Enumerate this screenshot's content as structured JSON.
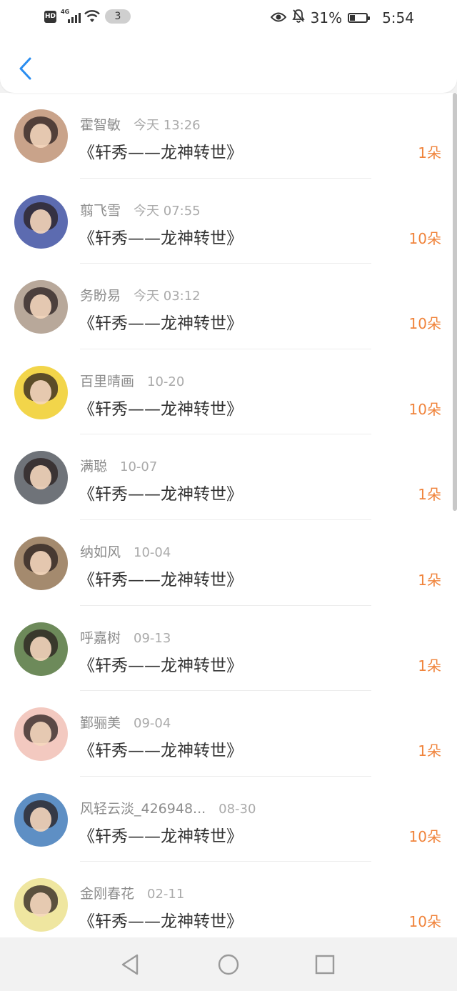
{
  "status_bar": {
    "hd_label": "HD",
    "network_label": "4G",
    "notification_count": "3",
    "battery_percent": "31%",
    "battery_level": 0.31,
    "time": "5:54"
  },
  "header": {
    "back_icon": "chevron-left-icon"
  },
  "colors": {
    "accent": "#2a8df0",
    "flower_count": "#f0843c",
    "name_text": "#8c8c8c",
    "title_text": "#333333"
  },
  "list": {
    "items": [
      {
        "name": "霍智敏",
        "time": "今天 13:26",
        "title": "《轩秀——龙神转世》",
        "flowers": "1朵",
        "avatar_bg": "#c9a38a"
      },
      {
        "name": "翦飞雪",
        "time": "今天 07:55",
        "title": "《轩秀——龙神转世》",
        "flowers": "10朵",
        "avatar_bg": "#5c6bb0"
      },
      {
        "name": "务盼易",
        "time": "今天 03:12",
        "title": "《轩秀——龙神转世》",
        "flowers": "10朵",
        "avatar_bg": "#b8a89a"
      },
      {
        "name": "百里晴画",
        "time": "10-20",
        "title": "《轩秀——龙神转世》",
        "flowers": "10朵",
        "avatar_bg": "#f2d54a"
      },
      {
        "name": "满聪",
        "time": "10-07",
        "title": "《轩秀——龙神转世》",
        "flowers": "1朵",
        "avatar_bg": "#6f7379"
      },
      {
        "name": "纳如风",
        "time": "10-04",
        "title": "《轩秀——龙神转世》",
        "flowers": "1朵",
        "avatar_bg": "#a48a6e"
      },
      {
        "name": "呼嘉树",
        "time": "09-13",
        "title": "《轩秀——龙神转世》",
        "flowers": "1朵",
        "avatar_bg": "#6d8a5a"
      },
      {
        "name": "鄞骊美",
        "time": "09-04",
        "title": "《轩秀——龙神转世》",
        "flowers": "1朵",
        "avatar_bg": "#f3c9c0"
      },
      {
        "name": "风轻云淡_426948...",
        "time": "08-30",
        "title": "《轩秀——龙神转世》",
        "flowers": "10朵",
        "avatar_bg": "#5e8fc4"
      },
      {
        "name": "金刚春花",
        "time": "02-11",
        "title": "《轩秀——龙神转世》",
        "flowers": "10朵",
        "avatar_bg": "#efe6a0"
      }
    ]
  },
  "nav_bar": {
    "back_icon": "triangle-back-icon",
    "home_icon": "circle-home-icon",
    "recents_icon": "square-recents-icon"
  }
}
